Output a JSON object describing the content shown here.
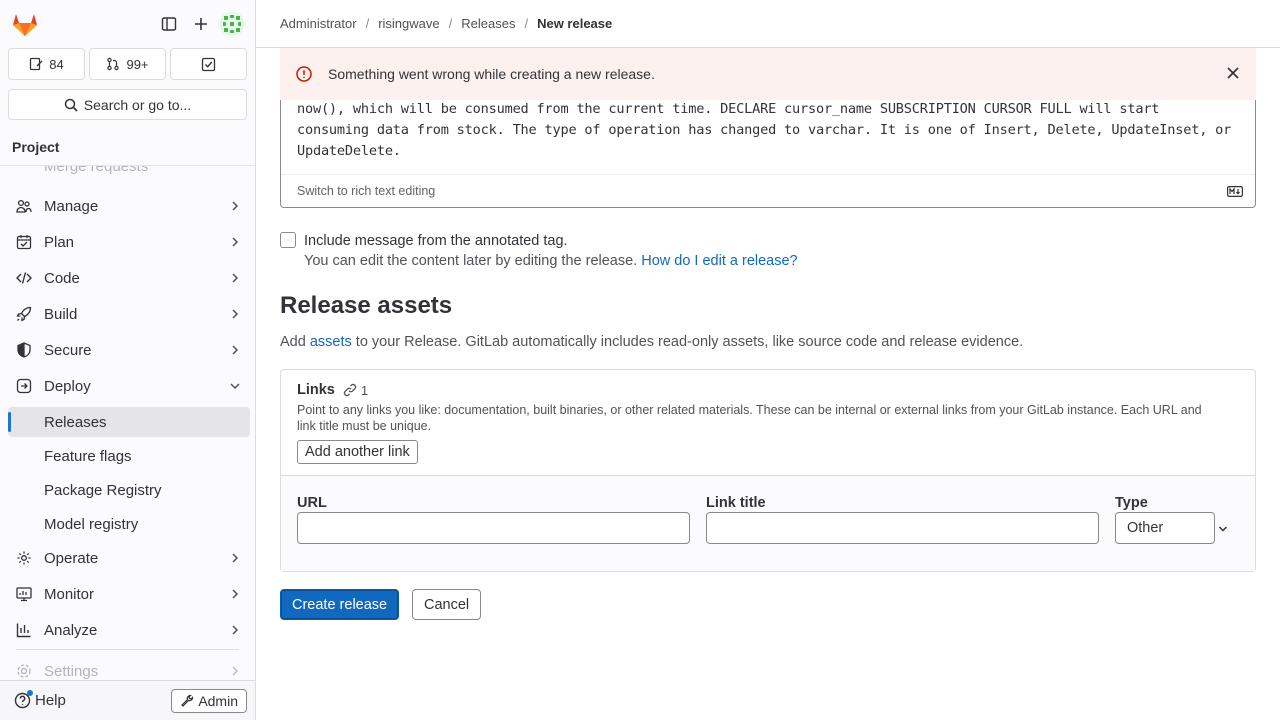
{
  "sidebar": {
    "counters": {
      "issues": "84",
      "merge_requests": "99+"
    },
    "search_label": "Search or go to...",
    "section_title": "Project",
    "faded_item": "Merge requests",
    "nav": [
      {
        "label": "Manage",
        "icon": "users-icon"
      },
      {
        "label": "Plan",
        "icon": "planning-icon"
      },
      {
        "label": "Code",
        "icon": "code-icon"
      },
      {
        "label": "Build",
        "icon": "rocket-icon"
      },
      {
        "label": "Secure",
        "icon": "shield-icon"
      },
      {
        "label": "Deploy",
        "icon": "deploy-icon",
        "expanded": true
      }
    ],
    "deploy_items": [
      "Releases",
      "Feature flags",
      "Package Registry",
      "Model registry"
    ],
    "active_item": "Releases",
    "nav_after": [
      {
        "label": "Operate",
        "icon": "cloud-gear-icon"
      },
      {
        "label": "Monitor",
        "icon": "monitor-icon"
      },
      {
        "label": "Analyze",
        "icon": "chart-icon"
      }
    ],
    "settings_label": "Settings",
    "help_label": "Help",
    "admin_label": "Admin"
  },
  "breadcrumb": [
    "Administrator",
    "risingwave",
    "Releases",
    "New release"
  ],
  "alert": {
    "message": "Something went wrong while creating a new release.",
    "color": "#fcf1ef"
  },
  "editor": {
    "text": "now(), which will be consumed from the current time. DECLARE cursor_name SUBSCRIPTION CURSOR FULL will start consuming data from stock. The type of operation has changed to varchar. It is one of Insert, Delete, UpdateInset, or UpdateDelete.",
    "switch_label": "Switch to rich text editing",
    "md_badge": "M↓"
  },
  "include_tag": {
    "label": "Include message from the annotated tag.",
    "help_prefix": "You can edit the content later by editing the release.",
    "help_link": "How do I edit a release?",
    "checked": false
  },
  "assets": {
    "heading": "Release assets",
    "desc_prefix": "Add",
    "desc_link": "assets",
    "desc_suffix": "to your Release. GitLab automatically includes read-only assets, like source code and release evidence."
  },
  "links": {
    "title": "Links",
    "count": "1",
    "description": "Point to any links you like: documentation, built binaries, or other related materials. These can be internal or external links from your GitLab instance. Each URL and link title must be unique.",
    "add_button": "Add another link",
    "url_label": "URL",
    "url_value": "",
    "title_label": "Link title",
    "title_value": "",
    "type_label": "Type",
    "type_value": "Other"
  },
  "actions": {
    "create": "Create release",
    "cancel": "Cancel",
    "primary_color": "#1068bf"
  }
}
